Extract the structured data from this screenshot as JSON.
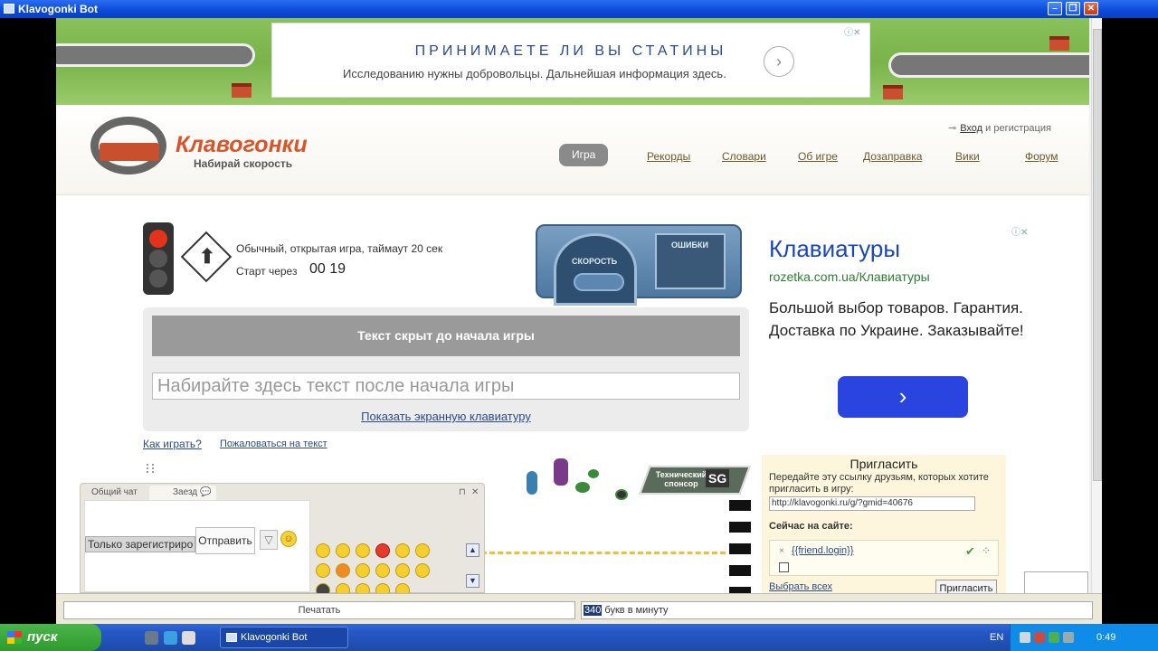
{
  "window": {
    "title": "Klavogonki Bot"
  },
  "banner": {
    "ad_heading": "ПРИНИМАЕТЕ ЛИ ВЫ СТАТИНЫ",
    "ad_text": "Исследованию нужны добровольцы. Дальнейшая информация здесь."
  },
  "header": {
    "logo_title": "Клавогонки",
    "logo_slogan": "Набирай скорость",
    "login_label": "Вход",
    "login_rest": "и регистрация",
    "nav": [
      "Игра",
      "Рекорды",
      "Словари",
      "Об игре",
      "Дозаправка",
      "Вики",
      "Форум"
    ]
  },
  "game": {
    "description": "Обычный, открытая игра, таймаут 20 сек",
    "start_label": "Старт через",
    "start_value": "00 19",
    "speed_label": "СКОРОСТЬ",
    "errors_label": "ОШИБКИ",
    "hidden_text": "Текст скрыт до начала игры",
    "input_placeholder": "Набирайте здесь текст после начала игры",
    "show_keyboard": "Показать экранную клавиатуру",
    "how_to_play": "Как играть?",
    "complain": "Пожаловаться на текст"
  },
  "sponsor": {
    "label": "Технический спонсор",
    "logo": "SG"
  },
  "chat": {
    "tab_general": "Общий чат",
    "tab_race": "Заезд",
    "only_registered": "Только зарегистриро",
    "send": "Отправить"
  },
  "ad_right": {
    "title": "Клавиатуры",
    "url": "rozetka.com.ua/Клавиатуры",
    "desc": "Большой выбор товаров. Гарантия. Доставка по Украине. Заказывайте!",
    "button": "›"
  },
  "invite": {
    "title": "Пригласить",
    "text": "Передайте эту ссылку друзьям, которых хотите пригласить в игру:",
    "link": "http://klavogonki.ru/g/?gmid=40676",
    "online_label": "Сейчас на сайте:",
    "friend": "{{friend.login}}",
    "select_all": "Выбрать всех",
    "button": "Пригласить"
  },
  "status": {
    "print": "Печатать",
    "speed_value": "340",
    "speed_unit": "букв в минуту"
  },
  "taskbar": {
    "start": "пуск",
    "task": "Klavogonki Bot",
    "lang": "EN",
    "clock": "0:49"
  },
  "colors": {
    "accent": "#d9542b",
    "ad_blue": "#1a47b8",
    "titlebar": "#0a49d6"
  }
}
